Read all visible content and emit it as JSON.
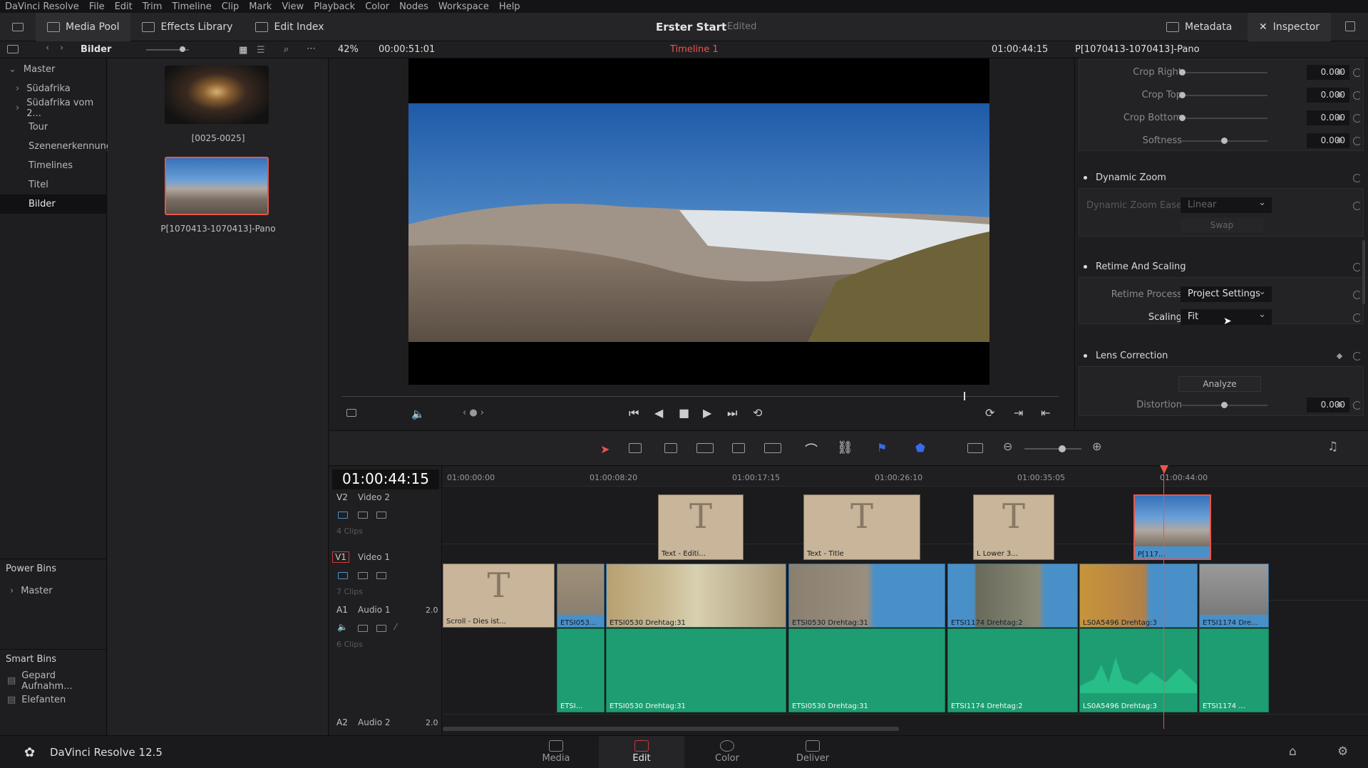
{
  "menu": [
    "DaVinci Resolve",
    "File",
    "Edit",
    "Trim",
    "Timeline",
    "Clip",
    "Mark",
    "View",
    "Playback",
    "Color",
    "Nodes",
    "Workspace",
    "Help"
  ],
  "toolbar": {
    "media_pool": "Media Pool",
    "effects_library": "Effects Library",
    "edit_index": "Edit Index",
    "project_title": "Erster Start",
    "project_status": "Edited",
    "metadata": "Metadata",
    "inspector": "Inspector"
  },
  "subbar": {
    "bin_name": "Bilder",
    "zoom": "42%",
    "duration": "00:00:51:01",
    "timeline_name": "Timeline 1",
    "timecode": "01:00:44:15",
    "clip_name": "P[1070413-1070413]-Pano"
  },
  "bins": {
    "master": "Master",
    "items": [
      "Südafrika",
      "Südafrika vom 2...",
      "Tour",
      "Szenenerkennung",
      "Timelines",
      "Titel",
      "Bilder"
    ],
    "power_bins_title": "Power Bins",
    "power_master": "Master",
    "smart_bins_title": "Smart Bins",
    "smart_items": [
      "Gepard Aufnahm...",
      "Elefanten"
    ]
  },
  "thumbs": [
    {
      "label": "[0025-0025]"
    },
    {
      "label": "P[1070413-1070413]-Pano"
    }
  ],
  "inspector": {
    "crop_right_label": "Crop Right",
    "crop_right": "0.000",
    "crop_top_label": "Crop Top",
    "crop_top": "0.000",
    "crop_bottom_label": "Crop Bottom",
    "crop_bottom": "0.000",
    "softness_label": "Softness",
    "softness": "0.000",
    "dynamic_zoom": "Dynamic Zoom",
    "dz_ease_label": "Dynamic Zoom Ease",
    "dz_ease": "Linear",
    "swap": "Swap",
    "retime_scaling": "Retime And Scaling",
    "retime_process_label": "Retime Process",
    "retime_process": "Project Settings",
    "scaling_label": "Scaling",
    "scaling": "Fit",
    "lens_correction": "Lens Correction",
    "analyze": "Analyze",
    "distortion_label": "Distortion",
    "distortion": "0.000"
  },
  "timeline": {
    "timecode": "01:00:44:15",
    "ruler": [
      "01:00:00:00",
      "01:00:08:20",
      "01:00:17:15",
      "01:00:26:10",
      "01:00:35:05",
      "01:00:44:00"
    ],
    "v2": {
      "id": "V2",
      "name": "Video 2",
      "clips_count": "4 Clips"
    },
    "v1": {
      "id": "V1",
      "name": "Video 1",
      "clips_count": "7 Clips"
    },
    "a1": {
      "id": "A1",
      "name": "Audio 1",
      "channels": "2.0",
      "clips_count": "6 Clips"
    },
    "a2": {
      "id": "A2",
      "name": "Audio 2",
      "channels": "2.0"
    },
    "v2_clips": [
      "Text - Editi...",
      "Text - Title",
      "L Lower 3...",
      "P[117..."
    ],
    "v1_clips": [
      "Scroll - Dies ist...",
      "ETSI053...",
      "ETSI0530 Drehtag:31",
      "ETSI0530 Drehtag:31",
      "ETSI1174 Drehtag:2",
      "LS0A5496 Drehtag:3",
      "ETSI1174 Dre..."
    ],
    "a1_clips": [
      "ETSI...",
      "ETSI0530 Drehtag:31",
      "ETSI0530 Drehtag:31",
      "ETSI1174 Drehtag:2",
      "LS0A5496 Drehtag:3",
      "ETSI1174 ..."
    ]
  },
  "bottom": {
    "app_name": "DaVinci Resolve 12.5",
    "tabs": [
      "Media",
      "Edit",
      "Color",
      "Deliver"
    ]
  },
  "colors": {
    "accent": "#e8564a",
    "audio": "#1f9d72",
    "video": "#4a90c8",
    "title": "#c8b59a"
  }
}
